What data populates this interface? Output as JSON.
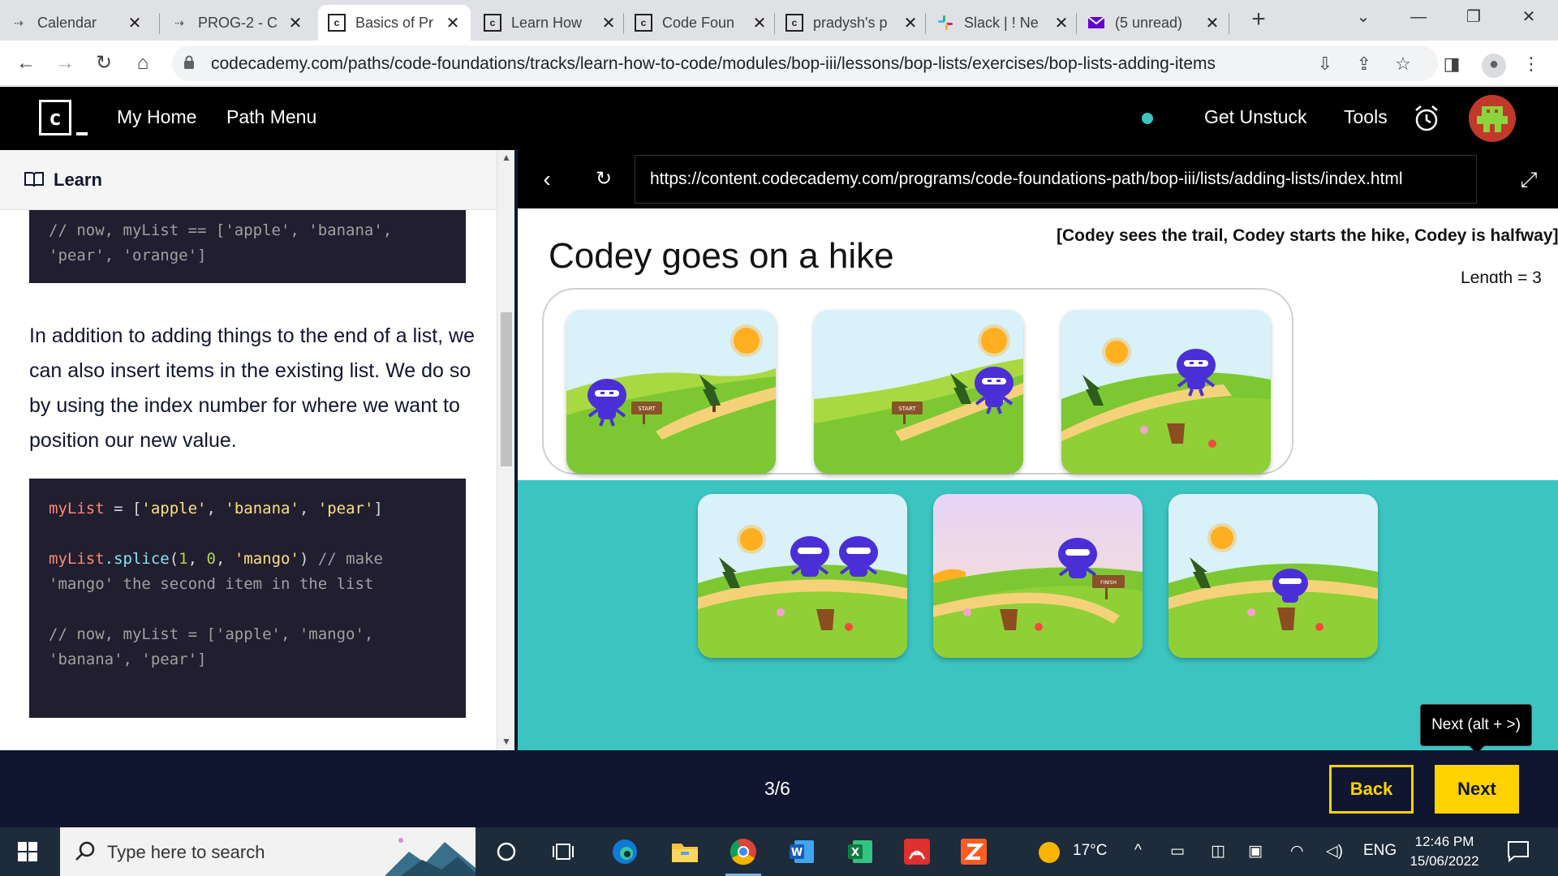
{
  "browser": {
    "tabs": [
      {
        "title": "Calendar",
        "favicon": "calendar-favicon"
      },
      {
        "title": "PROG-2 - C",
        "favicon": "prog-favicon"
      },
      {
        "title": "Basics of Pr",
        "favicon": "codecademy-favicon",
        "active": true
      },
      {
        "title": "Learn How",
        "favicon": "codecademy-favicon"
      },
      {
        "title": "Code Foun",
        "favicon": "codecademy-favicon"
      },
      {
        "title": "pradysh's p",
        "favicon": "codecademy-favicon"
      },
      {
        "title": "Slack | ! Ne",
        "favicon": "slack-favicon"
      },
      {
        "title": "(5 unread)",
        "favicon": "mail-favicon"
      }
    ],
    "new_tab": "+",
    "url": "codecademy.com/paths/code-foundations/tracks/learn-how-to-code/modules/bop-iii/lessons/bop-lists/exercises/bop-lists-adding-items"
  },
  "header": {
    "logo": "c",
    "nav": [
      "My Home",
      "Path Menu"
    ],
    "get_unstuck": "Get Unstuck",
    "tools": "Tools"
  },
  "learn": {
    "heading": "Learn",
    "code_top": [
      "// now, myList == ['apple', 'banana',",
      "'pear', 'orange']"
    ],
    "prose": "In addition to adding things to the end of a list, we can also insert items in the existing list. We do so by using the index number for where we want to position our new value.",
    "code_main": {
      "line1_var": "myList",
      "line1_op": " = [",
      "line1_s1": "'apple'",
      "line1_s2": "'banana'",
      "line1_s3": "'pear'",
      "line1_end": "]",
      "line2_var": "myList",
      "line2_fn": ".splice",
      "line2_open": "(",
      "line2_n1": "1",
      "line2_n2": "0",
      "line2_s": "'mango'",
      "line2_close": ")",
      "line2_cm1": " // make",
      "line2_cm2": "'mango' the second item in the list",
      "line3": "// now, myList = ['apple', 'mango',",
      "line4": "'banana', 'pear']"
    }
  },
  "preview": {
    "url": "https://content.codecademy.com/programs/code-foundations-path/bop-iii/lists/adding-lists/index.html",
    "title": "Codey goes on a hike",
    "list_text": "[Codey sees the trail, Codey starts the hike, Codey is halfway]",
    "length_text": "Length = 3",
    "sign_start": "START",
    "sign_finish": "FINISH"
  },
  "tooltip": "Next (alt + >)",
  "footer": {
    "pager": "3/6",
    "back": "Back",
    "next": "Next"
  },
  "taskbar": {
    "search_placeholder": "Type here to search",
    "weather": "17°C",
    "language": "ENG",
    "time": "12:46 PM",
    "date": "15/06/2022"
  },
  "colors": {
    "codecademy_navy": "#10162f",
    "accent_yellow": "#ffd300",
    "teal": "#3cc4c0",
    "codey_purple": "#4b2fd6"
  }
}
